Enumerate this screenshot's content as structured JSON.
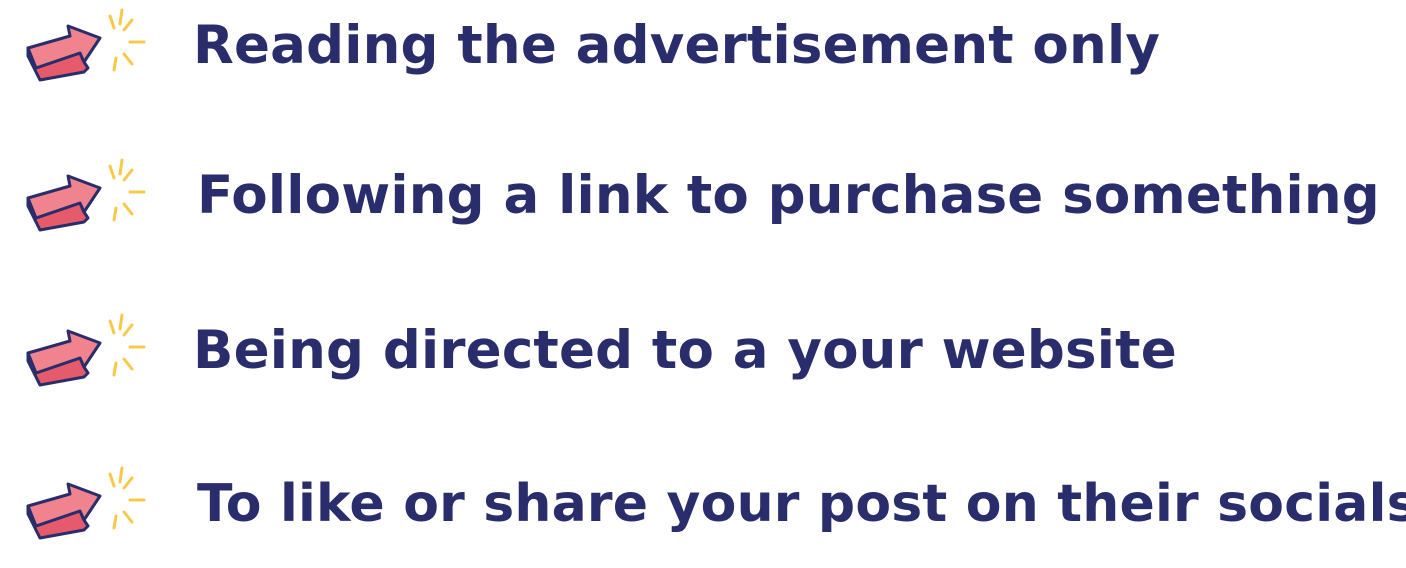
{
  "colors": {
    "text": "#2a2d6b",
    "arrow_fill": "#f0838e",
    "arrow_side": "#e65b6c",
    "arrow_outline": "#2a2d6b",
    "spark": "#f7c948"
  },
  "icon_name": "pointing-arrow-icon",
  "items": [
    {
      "label": "Reading the advertisement only"
    },
    {
      "label": "Following a link to purchase something"
    },
    {
      "label": "Being directed to a your website"
    },
    {
      "label": "To like or share your post on their socials"
    }
  ]
}
